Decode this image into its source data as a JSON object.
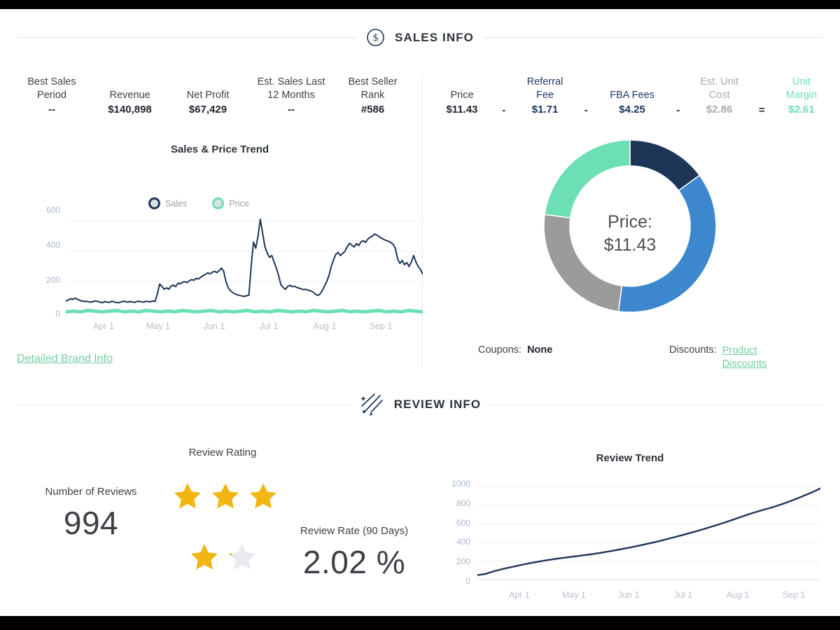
{
  "sections": {
    "sales": {
      "title": "SALES INFO",
      "icon": "dollar-circle-icon"
    },
    "review": {
      "title": "REVIEW INFO",
      "icon": "shooting-stars-icon"
    }
  },
  "sales_kpis": [
    {
      "label": "Best Sales Period",
      "value": "--"
    },
    {
      "label": "Revenue",
      "value": "$140,898"
    },
    {
      "label": "Net Profit",
      "value": "$67,429"
    },
    {
      "label": "Est. Sales Last 12 Months",
      "value": "--"
    },
    {
      "label": "Best Seller Rank",
      "value": "#586"
    }
  ],
  "price_breakdown": [
    {
      "label": "Price",
      "value": "$11.43",
      "style": "dark",
      "op": "-"
    },
    {
      "label": "Referral Fee",
      "value": "$1.71",
      "style": "navy",
      "op": "-"
    },
    {
      "label": "FBA Fees",
      "value": "$4.25",
      "style": "navy",
      "op": "-"
    },
    {
      "label": "Est. Unit Cost",
      "value": "$2.86",
      "style": "grey",
      "op": "="
    },
    {
      "label": "Unit Margin",
      "value": "$2.61",
      "style": "green",
      "op": ""
    }
  ],
  "detailed_brand_info_label": "Detailed Brand Info",
  "donut": {
    "center_line1": "Price:",
    "center_line2": "$11.43"
  },
  "coupons": {
    "key": "Coupons:",
    "value": "None"
  },
  "discounts": {
    "key": "Discounts:",
    "value": "Product Discounts"
  },
  "review": {
    "number_of_reviews_label": "Number of Reviews",
    "number_of_reviews_value": "994",
    "review_rating_label": "Review Rating",
    "review_rate_label": "Review Rate (90 Days)",
    "review_rate_value": "2.02 %"
  },
  "colors": {
    "navy": "#1d3557",
    "blue": "#3d87ce",
    "grey": "#9b9b9b",
    "green": "#6ddfb4",
    "star_gold": "#f2b613",
    "star_empty": "#e8eaef",
    "link_green": "#6fce9f"
  },
  "chart_data": [
    {
      "type": "line",
      "title": "Sales & Price Trend",
      "xlabel": "",
      "ylabel": "",
      "ylim": [
        0,
        680
      ],
      "grid": true,
      "legend": [
        "Sales",
        "Price"
      ],
      "legend_position": "top-center",
      "xtick_labels": [
        "Apr 1",
        "May 1",
        "Jun 1",
        "Jul 1",
        "Aug 1",
        "Sep 1"
      ],
      "ytick_labels": [
        "0",
        "200",
        "400",
        "600"
      ],
      "ytick_values": [
        0,
        200,
        400,
        600
      ],
      "series": [
        {
          "name": "Sales",
          "color": "#1d3557",
          "values": [
            72,
            80,
            88,
            84,
            92,
            86,
            78,
            74,
            70,
            72,
            68,
            66,
            70,
            74,
            70,
            66,
            62,
            70,
            66,
            64,
            72,
            68,
            64,
            62,
            66,
            72,
            70,
            66,
            70,
            68,
            64,
            70,
            72,
            68,
            66,
            72,
            70,
            68,
            74,
            70,
            120,
            185,
            170,
            150,
            160,
            150,
            172,
            178,
            168,
            190,
            186,
            196,
            200,
            194,
            206,
            214,
            210,
            222,
            218,
            230,
            240,
            248,
            258,
            252,
            262,
            268,
            260,
            272,
            290,
            268,
            200,
            160,
            140,
            128,
            120,
            114,
            110,
            106,
            104,
            108,
            112,
            300,
            460,
            420,
            500,
            610,
            520,
            430,
            390,
            360,
            372,
            330,
            290,
            240,
            180,
            162,
            150,
            170,
            176,
            168,
            170,
            162,
            158,
            152,
            148,
            150,
            144,
            140,
            132,
            120,
            110,
            118,
            140,
            170,
            200,
            240,
            300,
            345,
            380,
            392,
            372,
            386,
            400,
            430,
            452,
            440,
            428,
            450,
            438,
            462,
            470,
            458,
            480,
            492,
            500,
            512,
            506,
            494,
            486,
            478,
            470,
            466,
            458,
            446,
            420,
            350,
            320,
            340,
            312,
            326,
            300,
            330,
            372,
            330,
            300,
            280,
            250
          ]
        },
        {
          "name": "Price",
          "color": "#6ddfb4",
          "values": [
            11.43,
            11.43,
            11.43,
            11.43,
            11.43,
            11.43,
            11.43,
            11.43,
            11.43,
            11.43,
            11.43,
            11.43,
            11.43,
            11.43,
            11.43,
            11.43,
            11.43,
            11.43,
            11.43,
            11.43,
            11.43,
            11.43,
            11.43,
            11.43,
            11.43,
            11.43,
            11.43,
            11.43,
            11.43,
            11.43,
            11.43,
            11.43,
            11.43,
            11.43,
            11.43,
            11.43,
            11.43,
            11.43,
            11.43,
            11.43,
            11.43,
            11.43,
            11.43,
            11.43,
            11.43,
            11.43,
            11.43,
            11.43,
            11.43,
            11.43
          ]
        }
      ]
    },
    {
      "type": "pie",
      "subtype": "donut",
      "title": "",
      "center_label": "Price: $11.43",
      "labels": [
        "Referral Fee",
        "FBA Fees",
        "Est. Unit Cost",
        "Unit Margin"
      ],
      "values": [
        1.71,
        4.25,
        2.86,
        2.61
      ],
      "total": 11.43,
      "colors": [
        "#1d3557",
        "#3d87ce",
        "#9b9b9b",
        "#6ddfb4"
      ]
    },
    {
      "type": "line",
      "title": "Review Trend",
      "xlabel": "",
      "ylabel": "",
      "ylim": [
        0,
        1050
      ],
      "grid": true,
      "xtick_labels": [
        "Apr 1",
        "May 1",
        "Jun 1",
        "Jul 1",
        "Aug 1",
        "Sep 1"
      ],
      "ytick_labels": [
        "0",
        "200",
        "400",
        "600",
        "800",
        "1000"
      ],
      "ytick_values": [
        0,
        200,
        400,
        600,
        800,
        1000
      ],
      "series": [
        {
          "name": "Reviews",
          "color": "#1d3557",
          "values": [
            48,
            55,
            62,
            78,
            92,
            104,
            116,
            126,
            136,
            146,
            156,
            166,
            175,
            184,
            192,
            200,
            208,
            215,
            222,
            228,
            234,
            240,
            246,
            252,
            258,
            264,
            270,
            277,
            284,
            292,
            300,
            308,
            316,
            325,
            334,
            343,
            352,
            362,
            372,
            382,
            392,
            403,
            414,
            426,
            438,
            450,
            462,
            474,
            487,
            500,
            513,
            526,
            540,
            554,
            568,
            582,
            597,
            612,
            628,
            644,
            660,
            676,
            692,
            708,
            722,
            736,
            750,
            762,
            775,
            790,
            806,
            822,
            840,
            858,
            876,
            895,
            914,
            934,
            955,
            978
          ]
        }
      ]
    }
  ]
}
